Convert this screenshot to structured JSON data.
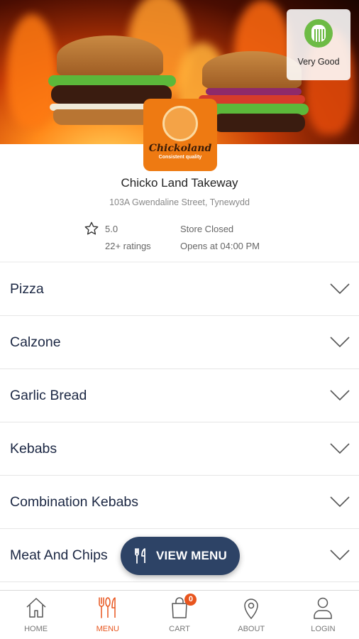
{
  "hero": {
    "rating_badge": {
      "label": "Very Good",
      "icon": "food-hygiene-rating-icon",
      "color": "#6dbb45"
    },
    "logo": {
      "brand": "Chickoland",
      "tagline": "Consistent quality",
      "bg_color": "#ee7a12"
    }
  },
  "store": {
    "name": "Chicko Land Takeway",
    "address": "103A Gwendaline Street, Tynewydd",
    "rating": "5.0",
    "ratings_count": "22+ ratings",
    "status": "Store Closed",
    "opens_at": "Opens at 04:00 PM"
  },
  "categories": [
    {
      "name": "Pizza"
    },
    {
      "name": "Calzone"
    },
    {
      "name": "Garlic Bread"
    },
    {
      "name": "Kebabs"
    },
    {
      "name": "Combination Kebabs"
    },
    {
      "name": "Meat And Chips"
    }
  ],
  "view_menu": {
    "label": "VIEW MENU",
    "icon": "cutlery-icon",
    "bg_color": "#2d4366"
  },
  "nav": {
    "items": [
      {
        "label": "HOME",
        "icon": "home-icon"
      },
      {
        "label": "MENU",
        "icon": "menu-icon",
        "active": true
      },
      {
        "label": "CART",
        "icon": "cart-icon",
        "badge": "0"
      },
      {
        "label": "ABOUT",
        "icon": "location-pin-icon"
      },
      {
        "label": "LOGIN",
        "icon": "user-icon"
      }
    ],
    "active_color": "#e8551e"
  }
}
